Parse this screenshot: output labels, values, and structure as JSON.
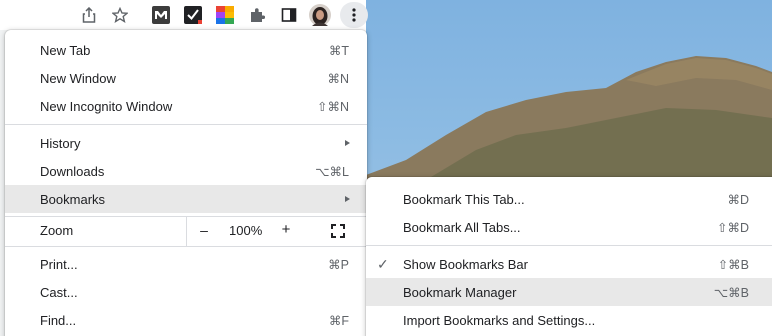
{
  "toolbar": {
    "icons": [
      "share-icon",
      "star-icon",
      "m-extension-icon",
      "checkmark-extension-icon",
      "color-palette-extension-icon",
      "puzzle-extensions-icon",
      "sidebar-icon",
      "profile-avatar",
      "kebab-menu-icon"
    ]
  },
  "menu": {
    "new_tab": {
      "label": "New Tab",
      "shortcut": "⌘T"
    },
    "new_window": {
      "label": "New Window",
      "shortcut": "⌘N"
    },
    "new_incognito": {
      "label": "New Incognito Window",
      "shortcut": "⇧⌘N"
    },
    "history": {
      "label": "History"
    },
    "downloads": {
      "label": "Downloads",
      "shortcut": "⌥⌘L"
    },
    "bookmarks": {
      "label": "Bookmarks"
    },
    "zoom": {
      "label": "Zoom",
      "minus": "–",
      "value": "100%",
      "plus": "+"
    },
    "print": {
      "label": "Print...",
      "shortcut": "⌘P"
    },
    "cast": {
      "label": "Cast..."
    },
    "find": {
      "label": "Find...",
      "shortcut": "⌘F"
    }
  },
  "bookmarks_submenu": {
    "bookmark_tab": {
      "label": "Bookmark This Tab...",
      "shortcut": "⌘D"
    },
    "bookmark_all": {
      "label": "Bookmark All Tabs...",
      "shortcut": "⇧⌘D"
    },
    "show_bar": {
      "label": "Show Bookmarks Bar",
      "shortcut": "⇧⌘B",
      "checked": true,
      "check": "✓"
    },
    "manager": {
      "label": "Bookmark Manager",
      "shortcut": "⌥⌘B"
    },
    "import": {
      "label": "Import Bookmarks and Settings..."
    }
  },
  "colors": {
    "menu_bg": "#ffffff",
    "hover_bg": "#e8e8e8",
    "separator": "#dadce0",
    "text": "#202124",
    "secondary_text": "#5f6368"
  }
}
